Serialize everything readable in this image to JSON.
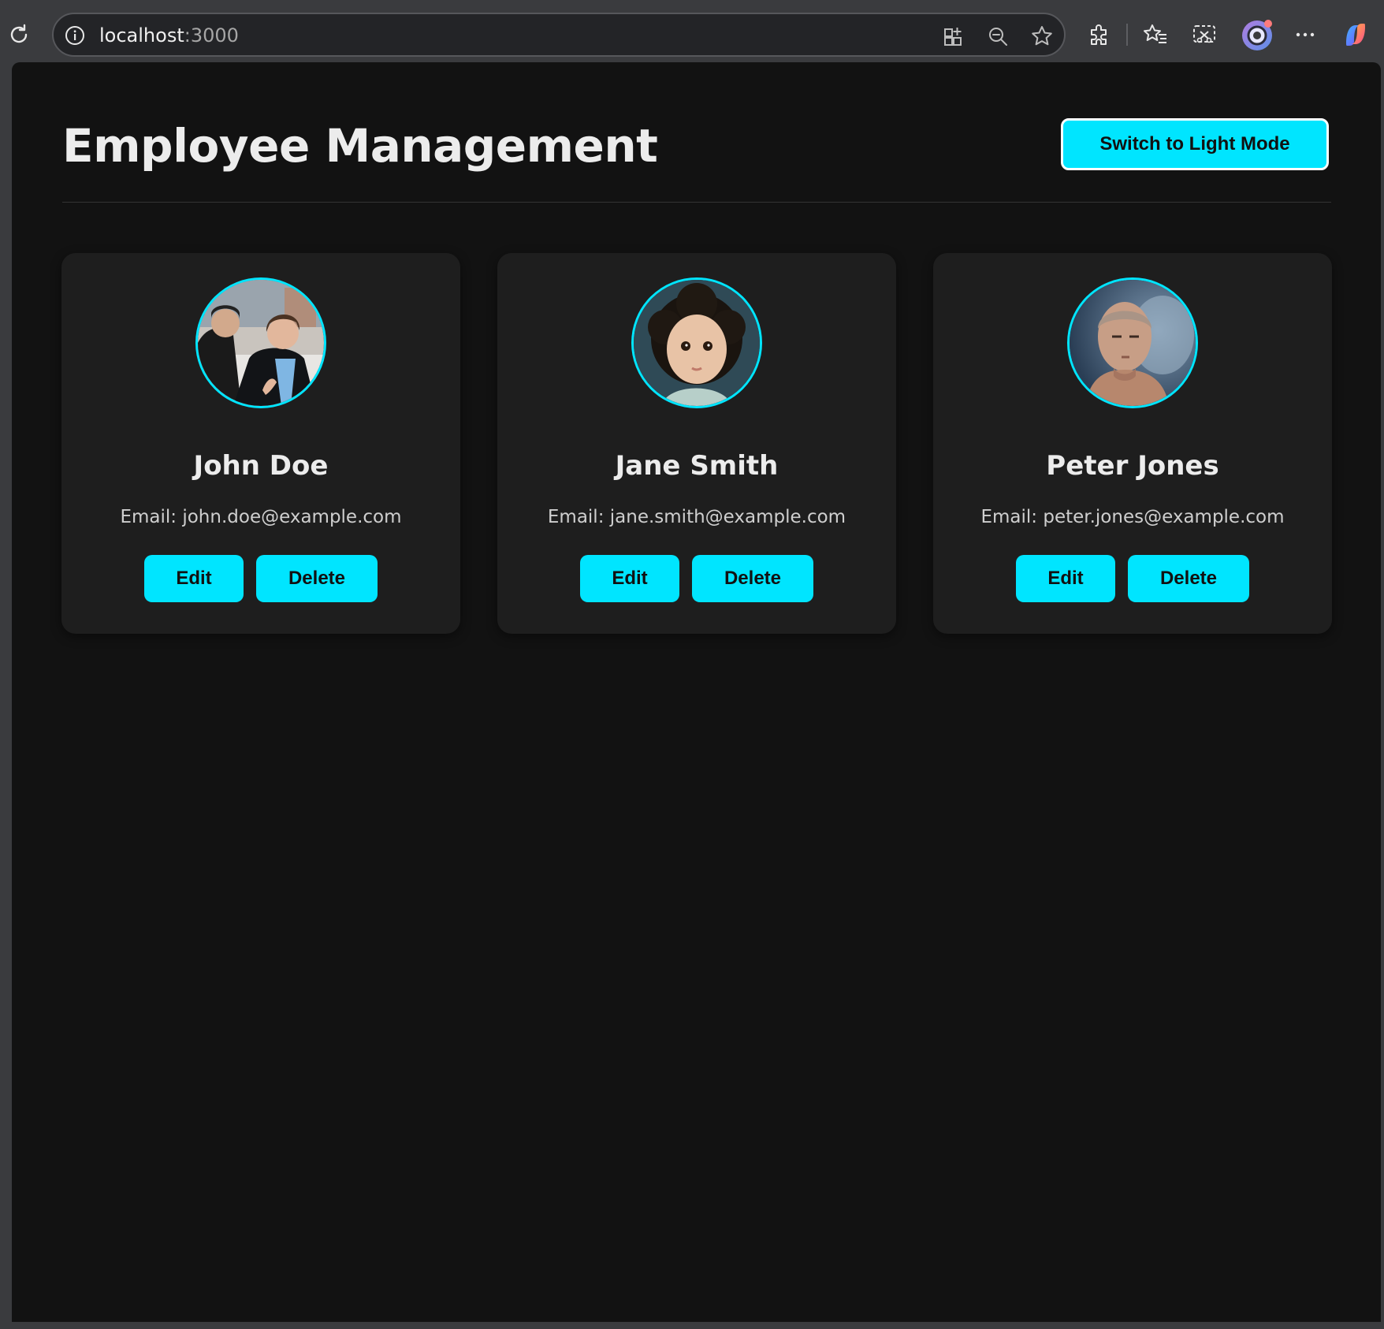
{
  "browser": {
    "url_host": "localhost",
    "url_port": ":3000",
    "icons": [
      "reload-icon",
      "site-info-icon",
      "app-grid-icon",
      "zoom-out-icon",
      "favorite-star-icon",
      "extensions-icon",
      "favorites-list-icon",
      "screenshot-icon",
      "profile-avatar-icon",
      "more-options-icon",
      "copilot-icon"
    ]
  },
  "page": {
    "title": "Employee Management",
    "mode_toggle_label": "Switch to Light Mode",
    "accent_color": "#00e5ff",
    "background_color": "#121212",
    "card_color": "#1e1e1e"
  },
  "employees": [
    {
      "name": "John Doe",
      "email": "Email: john.doe@example.com",
      "edit_label": "Edit",
      "delete_label": "Delete"
    },
    {
      "name": "Jane Smith",
      "email": "Email: jane.smith@example.com",
      "edit_label": "Edit",
      "delete_label": "Delete"
    },
    {
      "name": "Peter Jones",
      "email": "Email: peter.jones@example.com",
      "edit_label": "Edit",
      "delete_label": "Delete"
    }
  ]
}
